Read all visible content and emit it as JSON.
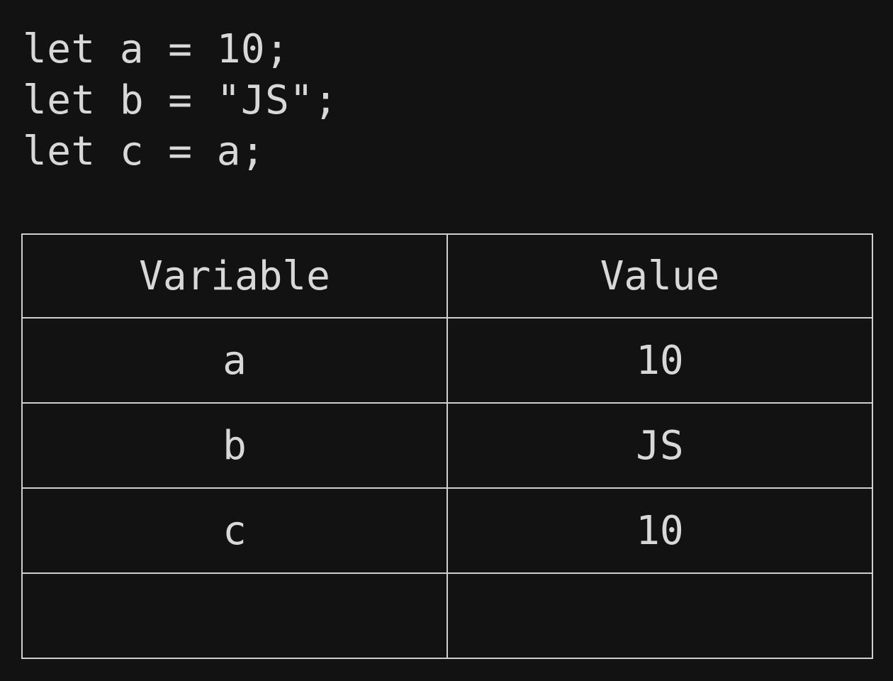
{
  "code": {
    "lines": [
      "let a = 10;",
      "let b = \"JS\";",
      "let c = a;"
    ]
  },
  "table": {
    "headers": [
      "Variable",
      "Value"
    ],
    "rows": [
      [
        "a",
        "10"
      ],
      [
        "b",
        "JS"
      ],
      [
        "c",
        "10"
      ],
      [
        "",
        ""
      ]
    ]
  }
}
